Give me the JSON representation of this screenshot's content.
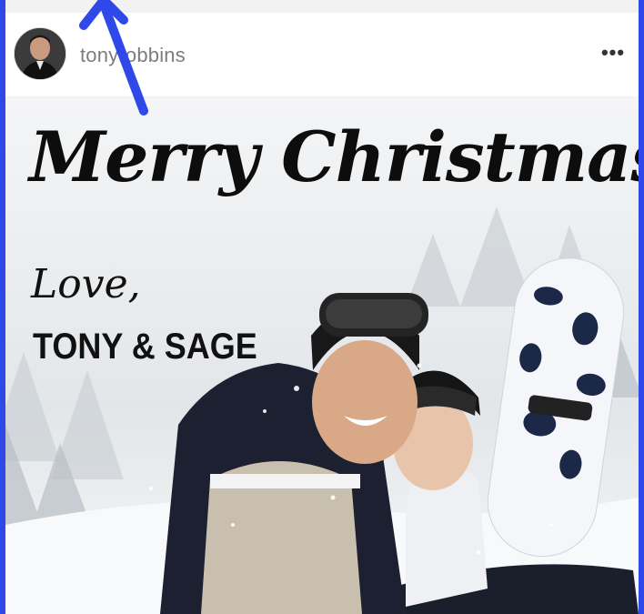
{
  "post": {
    "username": "tonyrobbins",
    "more_icon": "more-horizontal-icon",
    "more_glyph": "•••"
  },
  "image_text": {
    "headline": "Merry Christmas",
    "love": "Love,",
    "names": "TONY & SAGE"
  },
  "annotation": {
    "arrow_color": "#2f49e8"
  },
  "colors": {
    "frame": "#2f49e8",
    "username": "#7d7d7d"
  }
}
